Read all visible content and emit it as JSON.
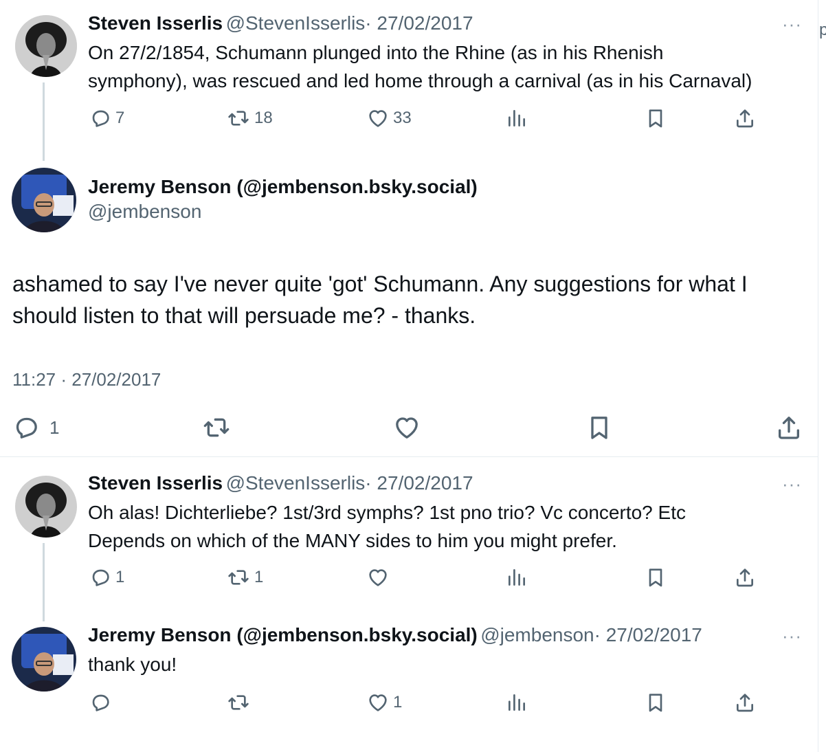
{
  "tweet1": {
    "name": "Steven Isserlis",
    "handle": "@StevenIsserlis",
    "date": "· 27/02/2017",
    "more": "···",
    "line1": "On 27/2/1854, Schumann plunged into the Rhine (as in his Rhenish",
    "line2": "symphony), was rescued and led home through a carnival (as in his Carnaval)",
    "replies": "7",
    "retweets": "18",
    "likes": "33"
  },
  "main": {
    "name": "Jeremy Benson (@jembenson.bsky.social)",
    "handle": "@jembenson",
    "line1": "ashamed to say I've never quite 'got' Schumann. Any suggestions for what I",
    "line2": "should listen to that will persuade me? - thanks.",
    "timestamp": "11:27 · 27/02/2017",
    "replies": "1"
  },
  "tweet3": {
    "name": "Steven Isserlis",
    "handle": "@StevenIsserlis",
    "date": "· 27/02/2017",
    "more": "···",
    "line1": "Oh alas! Dichterliebe? 1st/3rd symphs? 1st pno trio? Vc concerto? Etc",
    "line2": "Depends on which of the MANY sides to him you might prefer.",
    "replies": "1",
    "retweets": "1"
  },
  "tweet4": {
    "name": "Jeremy Benson (@jembenson.bsky.social)",
    "handle": "@jembenson",
    "date": "· 27/02/2017",
    "more": "···",
    "line1": "thank you!",
    "likes": "1"
  },
  "edge_text": "p",
  "icons": [
    "reply-icon",
    "retweet-icon",
    "like-icon",
    "views-icon",
    "bookmark-icon",
    "share-icon",
    "more-icon"
  ],
  "colors": {
    "text": "#0f1419",
    "secondary": "#536471",
    "thread": "#cfd9de",
    "divider": "#e6ecf0"
  }
}
